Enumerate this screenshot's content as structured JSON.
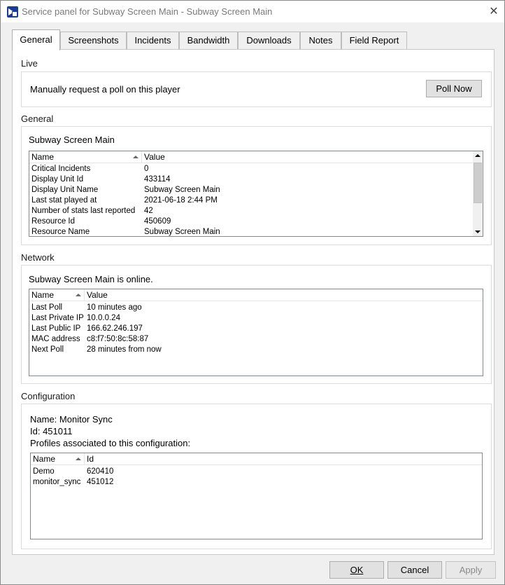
{
  "window": {
    "title": "Service panel for Subway Screen Main - Subway Screen Main",
    "close_glyph": "✕"
  },
  "tabs": [
    {
      "label": "General",
      "active": true
    },
    {
      "label": "Screenshots",
      "active": false
    },
    {
      "label": "Incidents",
      "active": false
    },
    {
      "label": "Bandwidth",
      "active": false
    },
    {
      "label": "Downloads",
      "active": false
    },
    {
      "label": "Notes",
      "active": false
    },
    {
      "label": "Field Report",
      "active": false
    }
  ],
  "live": {
    "heading": "Live",
    "text": "Manually request a poll on this player",
    "poll_button": "Poll Now"
  },
  "general": {
    "heading": "General",
    "subtitle": "Subway Screen Main",
    "columns": [
      "Name",
      "Value"
    ],
    "rows": [
      [
        "Critical Incidents",
        "0"
      ],
      [
        "Display Unit Id",
        "433114"
      ],
      [
        "Display Unit Name",
        "Subway Screen Main"
      ],
      [
        "Last stat played at",
        "2021-06-18 2:44 PM"
      ],
      [
        "Number of stats last reported",
        "42"
      ],
      [
        "Resource Id",
        "450609"
      ],
      [
        "Resource Name",
        "Subway Screen Main"
      ]
    ]
  },
  "network": {
    "heading": "Network",
    "status": "Subway Screen Main is online.",
    "columns": [
      "Name",
      "Value"
    ],
    "rows": [
      [
        "Last Poll",
        "10 minutes ago"
      ],
      [
        "Last Private IP",
        "10.0.0.24"
      ],
      [
        "Last Public IP",
        "166.62.246.197"
      ],
      [
        "MAC address",
        "c8:f7:50:8c:58:87"
      ],
      [
        "Next Poll",
        "28 minutes from now"
      ]
    ]
  },
  "configuration": {
    "heading": "Configuration",
    "name_line": "Name: Monitor Sync",
    "id_line": "Id: 451011",
    "profiles_label": "Profiles associated to this configuration:",
    "columns": [
      "Name",
      "Id"
    ],
    "rows": [
      [
        "Demo",
        "620410"
      ],
      [
        "monitor_sync",
        "451012"
      ]
    ]
  },
  "footer": {
    "ok": "OK",
    "cancel": "Cancel",
    "apply": "Apply"
  }
}
